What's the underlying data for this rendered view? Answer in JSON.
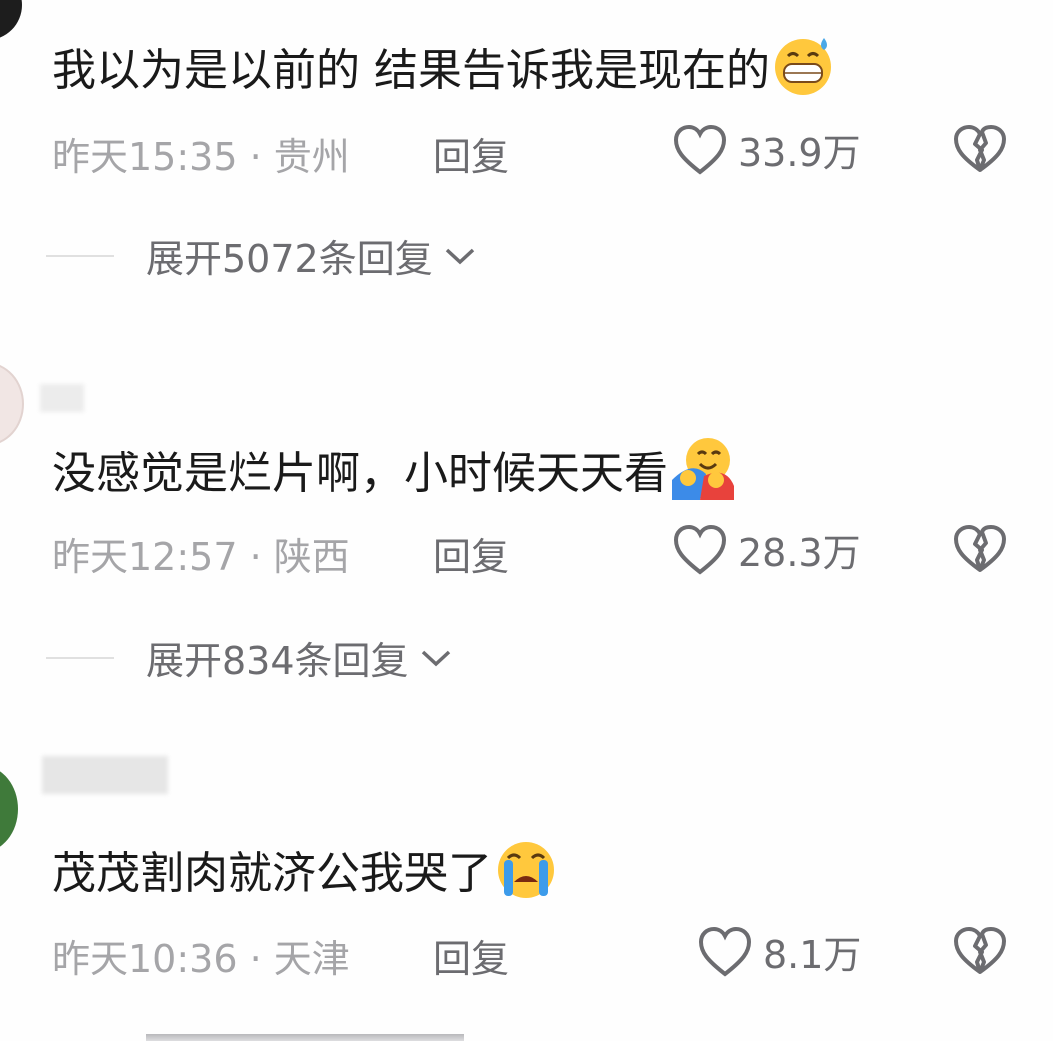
{
  "comments": [
    {
      "text": "我以为是以前的 结果告诉我是现在的",
      "emoji": "grinning-sweat-emoji",
      "time_loc": "昨天15:35 · 贵州",
      "reply": "回复",
      "likes": "33.9万",
      "expand": "展开5072条回复"
    },
    {
      "text": "没感觉是烂片啊，小时候天天看",
      "emoji": "hugging-face-emoji",
      "time_loc": "昨天12:57 · 陕西",
      "reply": "回复",
      "likes": "28.3万",
      "expand": "展开834条回复"
    },
    {
      "text": "茂茂割肉就济公我哭了",
      "emoji": "loudly-crying-emoji",
      "time_loc": "昨天10:36 · 天津",
      "reply": "回复",
      "likes": "8.1万"
    }
  ],
  "icons": {
    "like": "heart-outline-icon",
    "dislike": "broken-heart-icon",
    "expand": "chevron-down-icon"
  }
}
